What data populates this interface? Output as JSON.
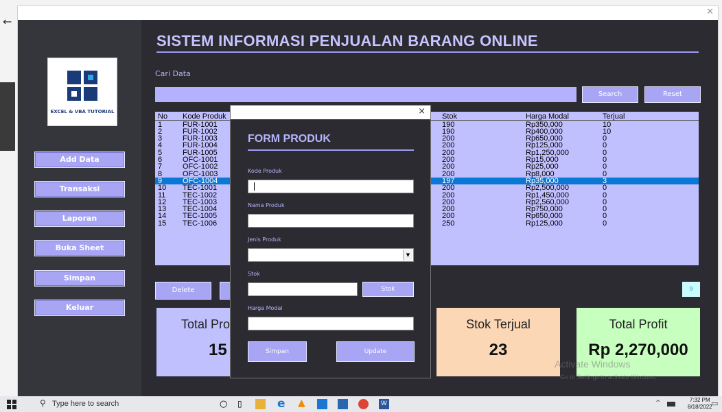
{
  "app": {
    "title": "SISTEM INFORMASI PENJUALAN BARANG ONLINE",
    "logo_text": "EXCEL & VBA TUTORIAL"
  },
  "sidebar": {
    "items": [
      {
        "label": "Add Data"
      },
      {
        "label": "Transaksi"
      },
      {
        "label": "Laporan"
      },
      {
        "label": "Buka Sheet"
      },
      {
        "label": "Simpan"
      },
      {
        "label": "Keluar"
      }
    ]
  },
  "search": {
    "label": "Cari Data",
    "value": "",
    "search_label": "Search",
    "reset_label": "Reset"
  },
  "table": {
    "columns": [
      "No",
      "Kode Produk",
      "Stok",
      "Harga Modal",
      "Terjual"
    ],
    "selected_index": 8,
    "rows": [
      {
        "no": "1",
        "kode": "FUR-1001",
        "stok": "190",
        "harga": "Rp350,000",
        "terjual": "10"
      },
      {
        "no": "2",
        "kode": "FUR-1002",
        "stok": "190",
        "harga": "Rp400,000",
        "terjual": "10"
      },
      {
        "no": "3",
        "kode": "FUR-1003",
        "stok": "200",
        "harga": "Rp650,000",
        "terjual": "0"
      },
      {
        "no": "4",
        "kode": "FUR-1004",
        "stok": "200",
        "harga": "Rp125,000",
        "terjual": "0"
      },
      {
        "no": "5",
        "kode": "FUR-1005",
        "stok": "200",
        "harga": "Rp1,250,000",
        "terjual": "0"
      },
      {
        "no": "6",
        "kode": "OFC-1001",
        "stok": "200",
        "harga": "Rp15,000",
        "terjual": "0"
      },
      {
        "no": "7",
        "kode": "OFC-1002",
        "stok": "200",
        "harga": "Rp25,000",
        "terjual": "0"
      },
      {
        "no": "8",
        "kode": "OFC-1003",
        "stok": "200",
        "harga": "Rp8,000",
        "terjual": "0"
      },
      {
        "no": "9",
        "kode": "OFC-1004",
        "stok": "197",
        "harga": "Rp35,000",
        "terjual": "3"
      },
      {
        "no": "10",
        "kode": "TEC-1001",
        "stok": "200",
        "harga": "Rp2,500,000",
        "terjual": "0"
      },
      {
        "no": "11",
        "kode": "TEC-1002",
        "stok": "200",
        "harga": "Rp1,450,000",
        "terjual": "0"
      },
      {
        "no": "12",
        "kode": "TEC-1003",
        "stok": "200",
        "harga": "Rp2,560,000",
        "terjual": "0"
      },
      {
        "no": "13",
        "kode": "TEC-1004",
        "stok": "200",
        "harga": "Rp750,000",
        "terjual": "0"
      },
      {
        "no": "14",
        "kode": "TEC-1005",
        "stok": "200",
        "harga": "Rp650,000",
        "terjual": "0"
      },
      {
        "no": "15",
        "kode": "TEC-1006",
        "stok": "250",
        "harga": "Rp125,000",
        "terjual": "0"
      }
    ]
  },
  "actions": {
    "delete_label": "Delete",
    "count_value": "9"
  },
  "cards": {
    "produk_label": "Total Pro",
    "produk_value": "15",
    "terjual_label": "Stok Terjual",
    "terjual_value": "23",
    "profit_label": "Total Profit",
    "profit_value": "Rp 2,270,000"
  },
  "watermark": {
    "line1": "Activate Windows",
    "line2": "Go to Settings to activate Windows"
  },
  "form_produk": {
    "heading": "FORM PRODUK",
    "close": "×",
    "kode_label": "Kode Produk",
    "nama_label": "Nama Produk",
    "jenis_label": "Jenis Produk",
    "stok_label": "Stok",
    "stok_button": "Stok",
    "harga_label": "Harga Modal",
    "simpan_label": "Simpan",
    "update_label": "Update"
  },
  "taskbar": {
    "search_placeholder": "Type here to search",
    "time": "7:32 PM",
    "date": "8/18/2022"
  },
  "colors": {
    "accent": "#a8a6f4",
    "list_bg": "#c1c0ff",
    "selected": "#0a78d7",
    "title": "#c6c4ff"
  }
}
